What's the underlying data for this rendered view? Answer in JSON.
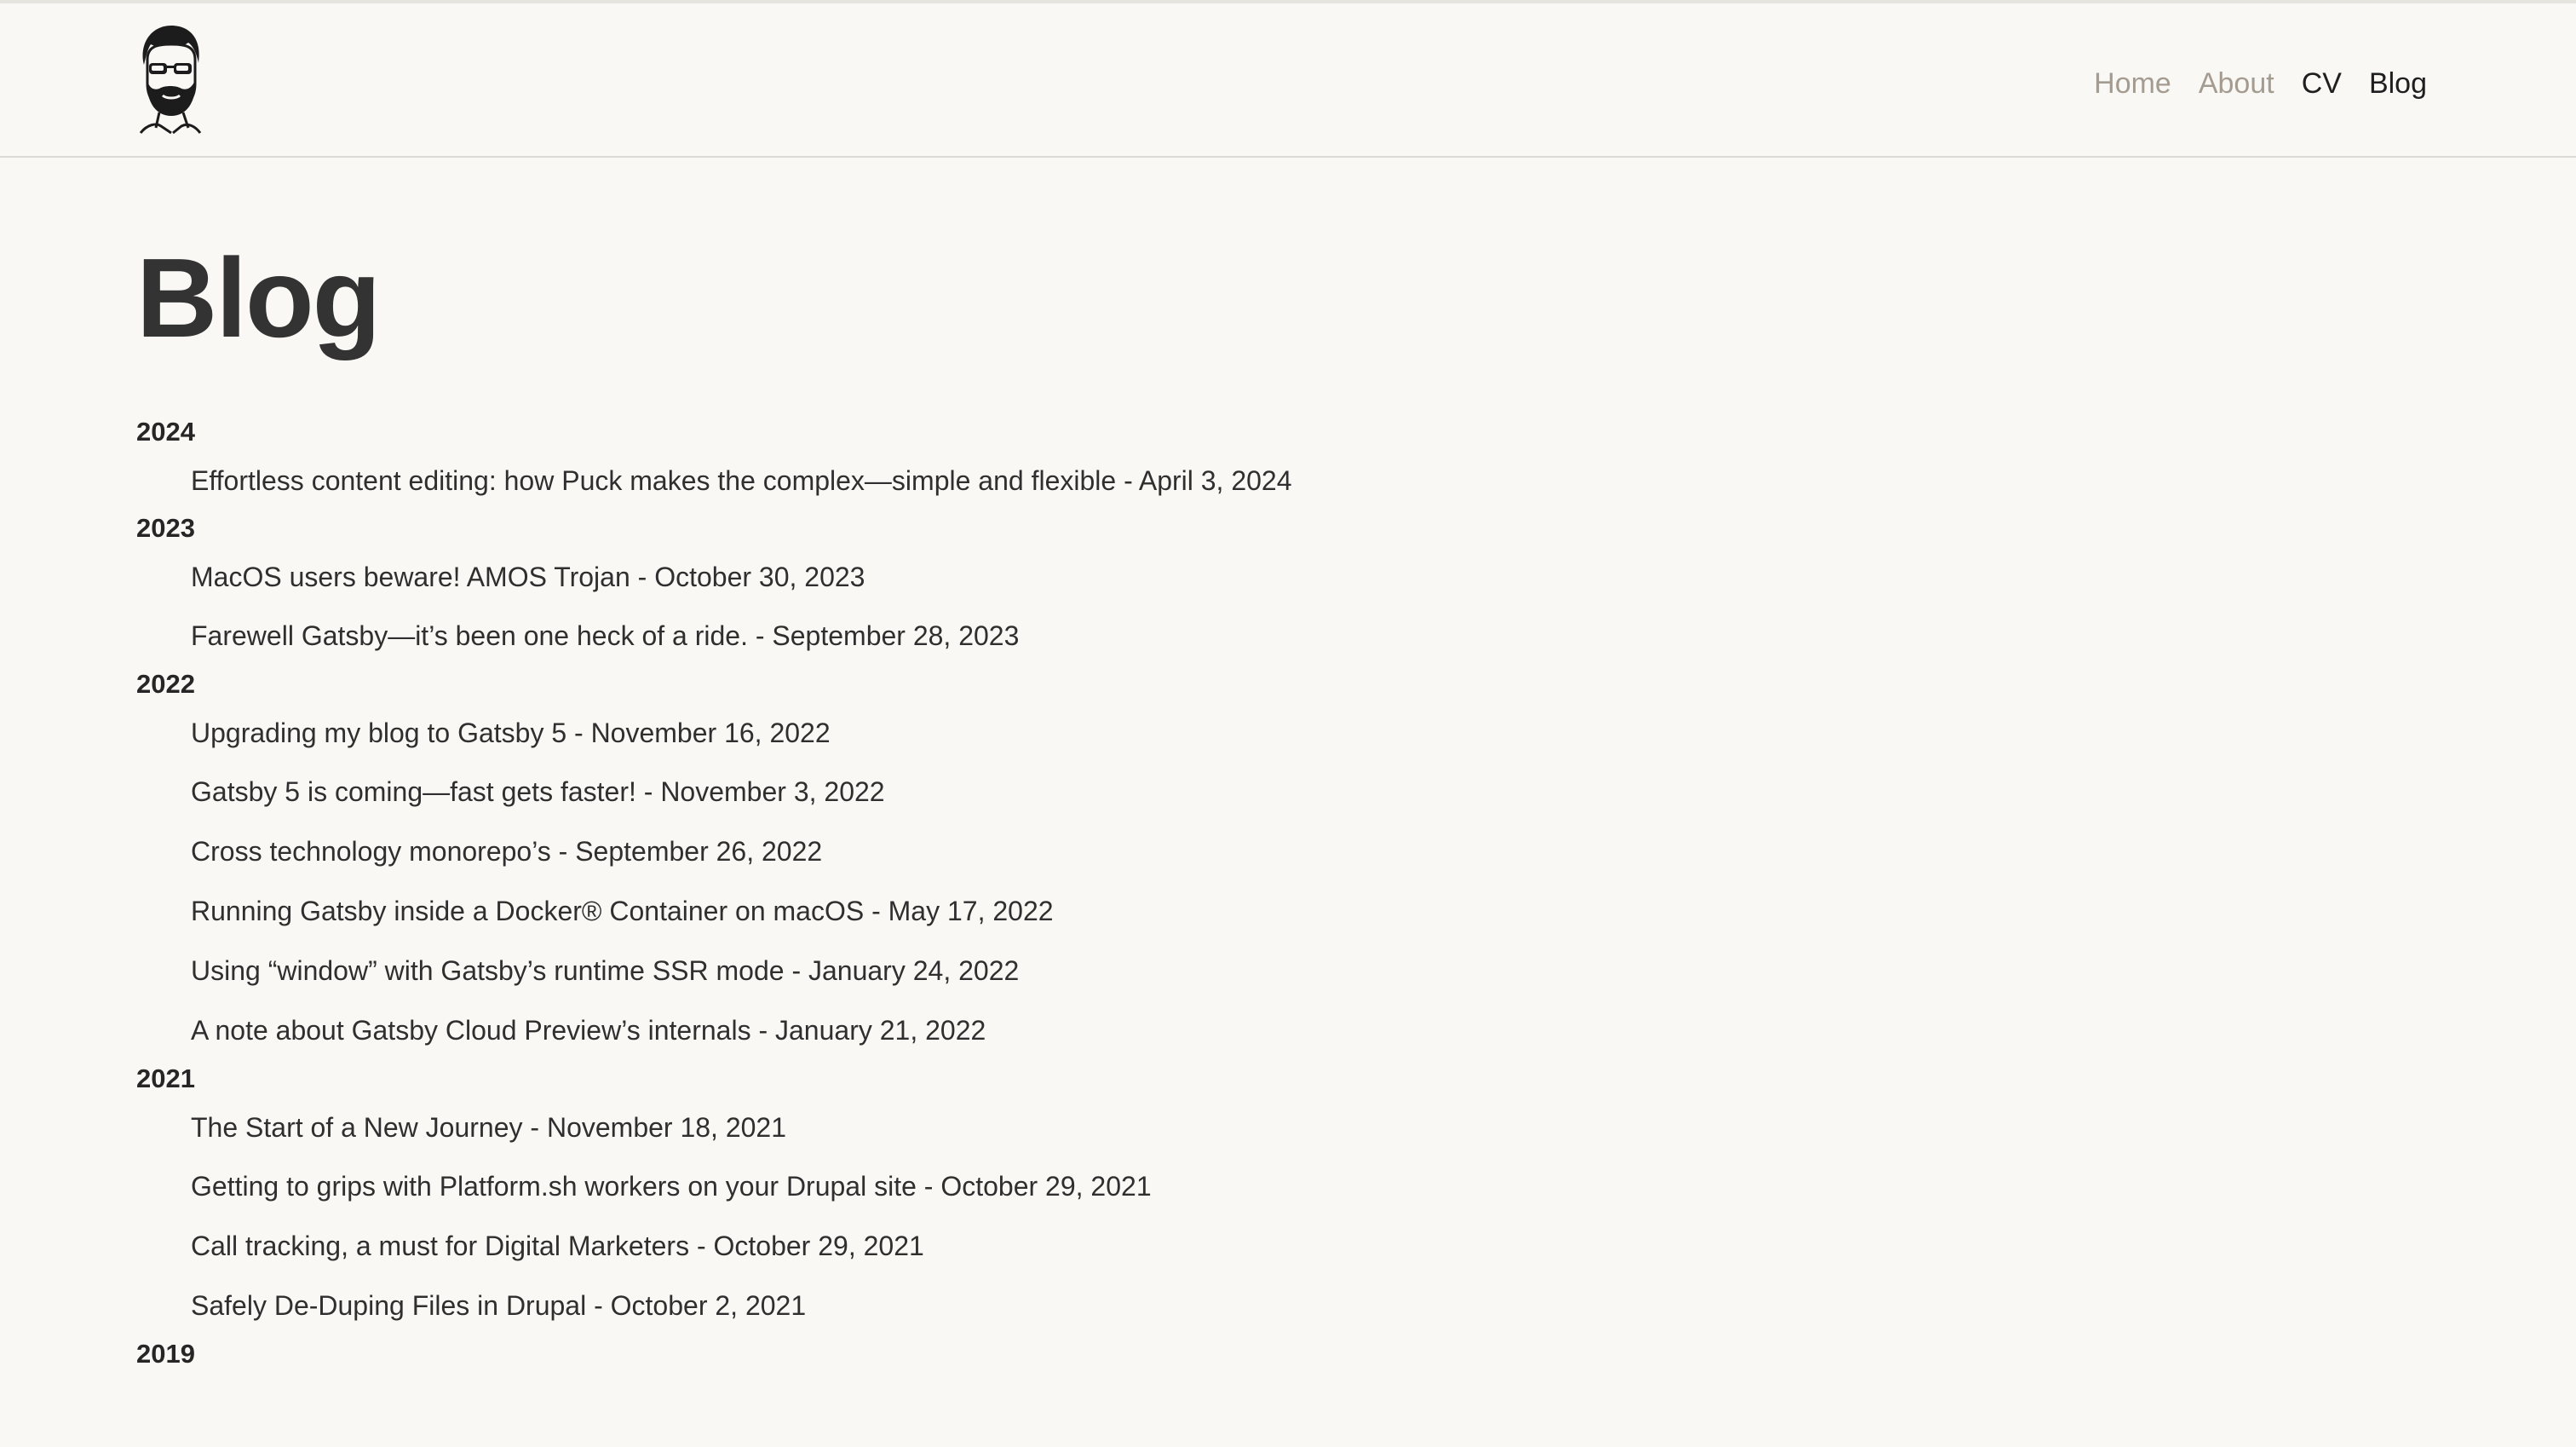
{
  "nav": {
    "items": [
      {
        "label": "Home",
        "state": "muted"
      },
      {
        "label": "About",
        "state": "muted"
      },
      {
        "label": "CV",
        "state": "active"
      },
      {
        "label": "Blog",
        "state": "active"
      }
    ]
  },
  "page": {
    "title": "Blog"
  },
  "years": [
    {
      "year": "2024",
      "posts": [
        {
          "title": "Effortless content editing: how Puck makes the complex—simple and flexible",
          "date": "April 3, 2024"
        }
      ]
    },
    {
      "year": "2023",
      "posts": [
        {
          "title": "MacOS users beware! AMOS Trojan",
          "date": "October 30, 2023"
        },
        {
          "title": "Farewell Gatsby—it’s been one heck of a ride.",
          "date": "September 28, 2023"
        }
      ]
    },
    {
      "year": "2022",
      "posts": [
        {
          "title": "Upgrading my blog to Gatsby 5",
          "date": "November 16, 2022"
        },
        {
          "title": "Gatsby 5 is coming—fast gets faster!",
          "date": "November 3, 2022"
        },
        {
          "title": "Cross technology monorepo’s",
          "date": "September 26, 2022"
        },
        {
          "title": "Running Gatsby inside a Docker® Container on macOS",
          "date": "May 17, 2022"
        },
        {
          "title": "Using “window” with Gatsby’s runtime SSR mode",
          "date": "January 24, 2022"
        },
        {
          "title": "A note about Gatsby Cloud Preview’s internals",
          "date": "January 21, 2022"
        }
      ]
    },
    {
      "year": "2021",
      "posts": [
        {
          "title": "The Start of a New Journey",
          "date": "November 18, 2021"
        },
        {
          "title": "Getting to grips with Platform.sh workers on your Drupal site",
          "date": "October 29, 2021"
        },
        {
          "title": "Call tracking, a must for Digital Marketers",
          "date": "October 29, 2021"
        },
        {
          "title": "Safely De-Duping Files in Drupal",
          "date": "October 2, 2021"
        }
      ]
    },
    {
      "year": "2019",
      "posts": []
    }
  ],
  "separator": " - ",
  "colors": {
    "background": "#f9f8f5",
    "text": "#2f2f2f",
    "nav_muted": "#a49b91",
    "nav_active": "#1f1f1f"
  }
}
